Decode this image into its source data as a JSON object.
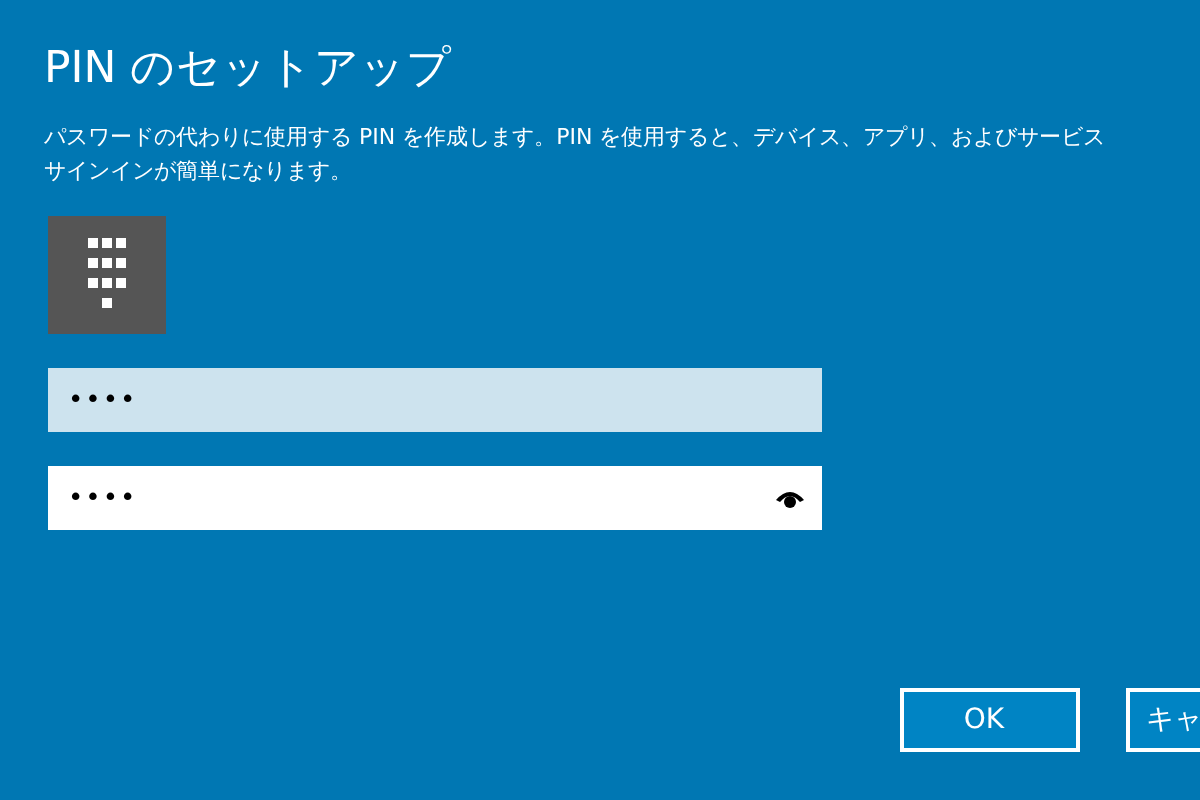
{
  "title": "PIN のセットアップ",
  "description": [
    "パスワードの代わりに使用する PIN を作成します。PIN を使用すると、デバイス、アプリ、およびサービス",
    "サインインが簡単になります。"
  ],
  "fields": [
    {
      "value": "••••",
      "focused": true,
      "reveal": false
    },
    {
      "value": "••••",
      "focused": false,
      "reveal": true
    }
  ],
  "buttons": [
    {
      "label": "OK"
    },
    {
      "label": "キャ"
    }
  ]
}
